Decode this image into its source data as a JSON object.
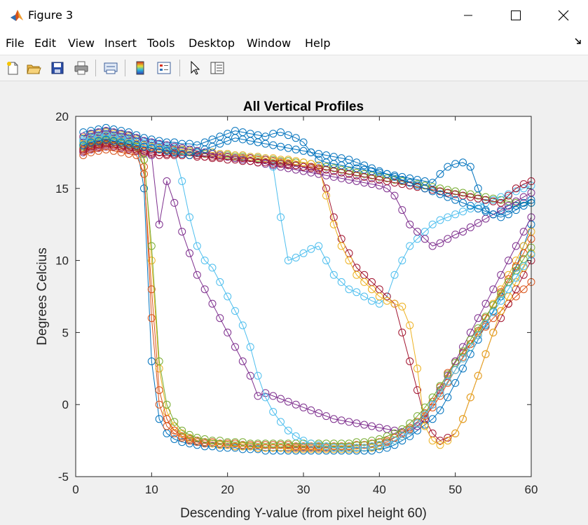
{
  "window": {
    "title": "Figure 3"
  },
  "menu": [
    "File",
    "Edit",
    "View",
    "Insert",
    "Tools",
    "Desktop",
    "Window",
    "Help"
  ],
  "toolbar_icons": [
    "new-figure-icon",
    "open-file-icon",
    "save-icon",
    "print-icon",
    "print-preview-icon",
    "colorbar-icon",
    "legend-icon",
    "pointer-icon",
    "property-inspector-icon"
  ],
  "chart_data": {
    "type": "line",
    "title": "All Vertical Profiles",
    "xlabel": "Descending Y-value (from pixel height 60)",
    "ylabel": "Degrees Celcius",
    "xlim": [
      0,
      60
    ],
    "ylim": [
      -5,
      20
    ],
    "xticks": [
      0,
      10,
      20,
      30,
      40,
      50,
      60
    ],
    "yticks": [
      -5,
      0,
      5,
      10,
      15,
      20
    ],
    "marker": "circle",
    "colors": [
      "#0072BD",
      "#D95319",
      "#EDB120",
      "#7E2F8E",
      "#77AC30",
      "#4DBEEE",
      "#A2142F"
    ],
    "x": [
      1,
      2,
      3,
      4,
      5,
      6,
      7,
      8,
      9,
      10,
      11,
      12,
      13,
      14,
      15,
      16,
      17,
      18,
      19,
      20,
      21,
      22,
      23,
      24,
      25,
      26,
      27,
      28,
      29,
      30,
      31,
      32,
      33,
      34,
      35,
      36,
      37,
      38,
      39,
      40,
      41,
      42,
      43,
      44,
      45,
      46,
      47,
      48,
      49,
      50,
      51,
      52,
      53,
      54,
      55,
      56,
      57,
      58,
      59,
      60
    ],
    "series": [
      {
        "values": [
          18.2,
          18.4,
          18.5,
          18.6,
          18.5,
          18.4,
          18.3,
          18.1,
          15.0,
          3.0,
          -1.0,
          -2.0,
          -2.4,
          -2.6,
          -2.7,
          -2.8,
          -2.9,
          -2.9,
          -3.0,
          -3.0,
          -3.0,
          -3.1,
          -3.1,
          -3.1,
          -3.2,
          -3.2,
          -3.2,
          -3.2,
          -3.2,
          -3.2,
          -3.2,
          -3.2,
          -3.2,
          -3.2,
          -3.2,
          -3.2,
          -3.2,
          -3.2,
          -3.2,
          -3.1,
          -3.0,
          -2.8,
          -2.5,
          -2.2,
          -1.8,
          -1.4,
          -1.0,
          -0.4,
          0.5,
          1.5,
          2.5,
          3.5,
          4.5,
          5.5,
          6.5,
          7.5,
          8.5,
          9.5,
          11.0,
          12.5
        ]
      },
      {
        "values": [
          17.8,
          18.0,
          18.1,
          18.2,
          18.2,
          18.1,
          18.0,
          17.9,
          16.5,
          6.0,
          0.0,
          -1.5,
          -2.0,
          -2.3,
          -2.5,
          -2.6,
          -2.7,
          -2.7,
          -2.8,
          -2.8,
          -2.9,
          -2.9,
          -2.9,
          -3.0,
          -3.0,
          -3.0,
          -3.0,
          -3.0,
          -3.0,
          -3.0,
          -3.0,
          -3.0,
          -3.0,
          -3.0,
          -3.0,
          -3.0,
          -3.0,
          -3.0,
          -2.9,
          -2.8,
          -2.6,
          -2.3,
          -2.0,
          -1.6,
          -1.2,
          -0.6,
          0.2,
          1.2,
          2.2,
          3.0,
          3.6,
          4.2,
          4.8,
          5.4,
          6.0,
          6.5,
          7.0,
          7.5,
          8.0,
          8.5
        ]
      },
      {
        "values": [
          18.5,
          18.7,
          18.8,
          18.9,
          18.8,
          18.7,
          18.6,
          18.4,
          17.5,
          10.0,
          2.5,
          -0.5,
          -1.5,
          -2.0,
          -2.3,
          -2.5,
          -2.6,
          -2.7,
          -2.8,
          -2.8,
          -2.9,
          -2.9,
          -2.9,
          -3.0,
          -3.0,
          -3.0,
          -3.0,
          -3.1,
          -3.1,
          -3.1,
          -3.1,
          -3.1,
          -3.1,
          -3.1,
          -3.1,
          -3.1,
          -3.1,
          -3.0,
          -3.0,
          -2.9,
          -2.7,
          -2.5,
          -2.2,
          -1.8,
          -1.3,
          -0.7,
          0.0,
          0.8,
          1.6,
          2.4,
          3.2,
          4.0,
          5.0,
          6.0,
          7.0,
          8.0,
          9.0,
          10.0,
          11.0,
          12.0
        ]
      },
      {
        "values": [
          17.5,
          17.7,
          17.8,
          17.9,
          17.9,
          17.8,
          17.7,
          17.6,
          17.4,
          17.3,
          12.5,
          15.5,
          14.0,
          12.0,
          10.5,
          9.0,
          8.0,
          7.0,
          6.0,
          5.0,
          4.0,
          3.0,
          2.0,
          0.6,
          0.8,
          0.6,
          0.4,
          0.2,
          0.0,
          -0.2,
          -0.4,
          -0.6,
          -0.8,
          -1.0,
          -1.1,
          -1.2,
          -1.3,
          -1.4,
          -1.5,
          -1.6,
          -1.7,
          -1.8,
          -1.9,
          -1.8,
          -1.5,
          -1.0,
          0.0,
          1.0,
          2.0,
          3.0,
          4.0,
          5.0,
          6.0,
          7.0,
          8.0,
          9.0,
          10.0,
          11.0,
          12.0,
          13.0
        ]
      },
      {
        "values": [
          18.0,
          18.2,
          18.3,
          18.4,
          18.3,
          18.2,
          18.1,
          18.0,
          17.9,
          17.8,
          17.7,
          17.7,
          17.6,
          17.6,
          17.5,
          17.5,
          17.4,
          17.4,
          17.3,
          17.3,
          17.2,
          17.2,
          17.1,
          17.1,
          17.0,
          17.0,
          16.9,
          16.9,
          16.8,
          16.8,
          16.7,
          16.6,
          16.5,
          16.4,
          16.3,
          16.2,
          16.1,
          16.0,
          15.9,
          15.8,
          15.7,
          15.6,
          15.5,
          15.4,
          15.3,
          15.2,
          15.1,
          15.0,
          14.9,
          14.8,
          14.7,
          14.6,
          14.5,
          14.4,
          14.3,
          14.2,
          14.1,
          14.0,
          14.0,
          14.0
        ]
      },
      {
        "values": [
          18.4,
          18.6,
          18.7,
          18.8,
          18.7,
          18.6,
          18.5,
          18.3,
          18.2,
          18.1,
          18.0,
          17.9,
          17.8,
          17.7,
          17.6,
          17.6,
          17.5,
          17.5,
          17.4,
          17.4,
          17.3,
          17.3,
          17.2,
          17.2,
          17.1,
          16.5,
          13.0,
          10.0,
          10.2,
          10.5,
          10.8,
          11.0,
          10.0,
          9.0,
          8.5,
          8.0,
          7.8,
          7.5,
          7.2,
          7.0,
          7.5,
          9.0,
          10.0,
          11.0,
          11.5,
          12.0,
          12.5,
          12.8,
          13.0,
          13.2,
          13.4,
          13.6,
          13.8,
          14.0,
          14.2,
          14.4,
          14.6,
          14.8,
          15.0,
          15.2
        ]
      },
      {
        "values": [
          17.6,
          17.8,
          17.9,
          18.0,
          17.9,
          17.8,
          17.7,
          17.6,
          17.5,
          17.4,
          17.3,
          17.3,
          17.3,
          17.3,
          17.3,
          17.3,
          17.2,
          17.2,
          17.2,
          17.2,
          17.1,
          17.1,
          17.1,
          17.0,
          17.0,
          16.9,
          16.8,
          16.7,
          16.6,
          16.5,
          16.4,
          16.3,
          15.0,
          13.0,
          11.5,
          10.5,
          9.5,
          9.0,
          8.5,
          8.0,
          7.5,
          7.0,
          5.0,
          3.0,
          1.0,
          -1.0,
          -2.0,
          -2.5,
          -2.3,
          -2.0,
          -1.0,
          0.5,
          2.0,
          3.5,
          5.0,
          6.0,
          7.0,
          8.0,
          9.0,
          10.0
        ]
      },
      {
        "values": [
          18.9,
          19.0,
          19.1,
          19.2,
          19.1,
          19.0,
          18.9,
          18.7,
          18.5,
          18.4,
          18.3,
          18.2,
          18.2,
          18.1,
          18.1,
          18.0,
          18.2,
          18.4,
          18.6,
          18.8,
          19.0,
          18.9,
          18.8,
          18.7,
          18.6,
          18.8,
          18.9,
          18.7,
          18.5,
          18.2,
          17.5,
          17.0,
          16.8,
          16.7,
          16.6,
          16.5,
          16.4,
          16.3,
          16.2,
          16.1,
          16.0,
          15.9,
          15.8,
          15.7,
          15.6,
          15.5,
          15.4,
          16.0,
          16.5,
          16.7,
          16.8,
          16.5,
          15.0,
          13.5,
          13.2,
          13.4,
          13.6,
          13.8,
          14.0,
          14.2
        ]
      },
      {
        "values": [
          17.3,
          17.5,
          17.6,
          17.7,
          17.6,
          17.5,
          17.4,
          17.3,
          16.0,
          8.0,
          1.0,
          -1.0,
          -1.8,
          -2.2,
          -2.4,
          -2.5,
          -2.6,
          -2.6,
          -2.7,
          -2.7,
          -2.7,
          -2.8,
          -2.8,
          -2.8,
          -2.8,
          -2.8,
          -2.8,
          -2.8,
          -2.9,
          -2.9,
          -2.9,
          -2.9,
          -2.9,
          -2.9,
          -2.9,
          -2.9,
          -2.8,
          -2.8,
          -2.7,
          -2.6,
          -2.5,
          -2.3,
          -2.0,
          -1.7,
          -1.3,
          -0.8,
          -0.2,
          0.6,
          1.5,
          2.4,
          3.3,
          4.2,
          5.1,
          6.0,
          6.9,
          7.8,
          8.7,
          9.6,
          10.5,
          11.5
        ]
      },
      {
        "values": [
          18.1,
          18.3,
          18.4,
          18.5,
          18.4,
          18.3,
          18.2,
          18.1,
          18.0,
          17.9,
          17.8,
          17.8,
          17.7,
          17.7,
          17.6,
          17.6,
          17.5,
          17.5,
          17.4,
          17.4,
          17.3,
          17.3,
          17.2,
          17.2,
          17.1,
          17.1,
          17.0,
          17.0,
          16.9,
          16.8,
          16.7,
          16.6,
          14.5,
          12.5,
          11.0,
          10.0,
          9.0,
          8.5,
          8.0,
          7.5,
          7.2,
          7.0,
          6.8,
          5.5,
          2.5,
          -1.5,
          -2.5,
          -2.8,
          -2.5,
          -2.0,
          -1.0,
          0.5,
          2.0,
          3.5,
          5.0,
          6.5,
          7.5,
          8.5,
          9.5,
          10.5
        ]
      },
      {
        "values": [
          18.6,
          18.8,
          18.9,
          19.0,
          18.9,
          18.8,
          18.7,
          18.5,
          18.3,
          18.2,
          18.1,
          18.0,
          17.9,
          17.8,
          17.7,
          17.6,
          17.5,
          17.4,
          17.3,
          17.2,
          17.1,
          17.0,
          16.9,
          16.8,
          16.7,
          16.6,
          16.5,
          16.4,
          16.3,
          16.2,
          16.1,
          16.0,
          15.9,
          15.8,
          15.7,
          15.6,
          15.5,
          15.4,
          15.3,
          15.2,
          15.0,
          14.5,
          13.5,
          12.5,
          12.0,
          11.5,
          11.0,
          11.2,
          11.5,
          11.8,
          12.0,
          12.3,
          12.6,
          12.9,
          13.2,
          13.5,
          13.8,
          14.1,
          14.4,
          14.7
        ]
      },
      {
        "values": [
          17.9,
          18.1,
          18.2,
          18.3,
          18.2,
          18.1,
          18.0,
          17.9,
          17.0,
          11.0,
          3.0,
          0.0,
          -1.2,
          -1.8,
          -2.1,
          -2.3,
          -2.4,
          -2.5,
          -2.5,
          -2.6,
          -2.6,
          -2.6,
          -2.7,
          -2.7,
          -2.7,
          -2.7,
          -2.7,
          -2.7,
          -2.7,
          -2.7,
          -2.7,
          -2.7,
          -2.7,
          -2.7,
          -2.7,
          -2.7,
          -2.6,
          -2.6,
          -2.5,
          -2.4,
          -2.2,
          -2.0,
          -1.7,
          -1.3,
          -0.8,
          -0.2,
          0.5,
          1.3,
          2.1,
          2.9,
          3.7,
          4.5,
          5.3,
          6.1,
          6.9,
          7.7,
          8.5,
          9.3,
          10.1,
          10.9
        ]
      },
      {
        "values": [
          18.3,
          18.5,
          18.6,
          18.7,
          18.6,
          18.5,
          18.4,
          18.2,
          18.1,
          18.0,
          17.9,
          17.8,
          17.5,
          15.5,
          13.0,
          11.0,
          10.0,
          9.5,
          8.5,
          7.5,
          6.5,
          5.5,
          4.0,
          2.0,
          0.5,
          -0.5,
          -1.2,
          -1.8,
          -2.2,
          -2.5,
          -2.7,
          -2.8,
          -2.9,
          -3.0,
          -3.0,
          -3.0,
          -3.0,
          -3.0,
          -2.9,
          -2.8,
          -2.7,
          -2.5,
          -2.2,
          -1.8,
          -1.3,
          -0.7,
          0.0,
          0.8,
          1.6,
          2.4,
          3.2,
          4.0,
          4.8,
          5.6,
          6.4,
          7.2,
          8.0,
          8.8,
          9.6,
          10.4
        ]
      },
      {
        "values": [
          17.7,
          17.9,
          18.0,
          18.1,
          18.0,
          17.9,
          17.8,
          17.7,
          17.6,
          17.5,
          17.5,
          17.4,
          17.4,
          17.3,
          17.3,
          17.2,
          17.2,
          17.1,
          17.1,
          17.0,
          17.0,
          16.9,
          16.9,
          16.8,
          16.8,
          16.7,
          16.7,
          16.6,
          16.6,
          16.5,
          16.5,
          16.4,
          16.3,
          16.2,
          16.1,
          16.0,
          15.9,
          15.8,
          15.7,
          15.6,
          15.5,
          15.4,
          15.3,
          15.2,
          15.1,
          15.0,
          14.9,
          14.8,
          14.7,
          14.6,
          14.5,
          14.4,
          14.3,
          14.2,
          14.1,
          14.0,
          14.5,
          15.0,
          15.3,
          15.5
        ]
      },
      {
        "values": [
          18.0,
          18.2,
          18.3,
          18.4,
          18.3,
          18.2,
          18.1,
          18.0,
          17.9,
          17.8,
          17.7,
          17.6,
          17.5,
          17.4,
          17.3,
          17.5,
          17.7,
          17.9,
          18.1,
          18.3,
          18.5,
          18.4,
          18.3,
          18.2,
          18.1,
          18.0,
          17.9,
          17.8,
          17.7,
          17.6,
          17.5,
          17.4,
          17.3,
          17.2,
          17.1,
          17.0,
          16.8,
          16.6,
          16.4,
          16.2,
          16.0,
          15.8,
          15.6,
          15.4,
          15.2,
          15.0,
          14.8,
          14.6,
          14.4,
          14.2,
          14.0,
          13.8,
          13.6,
          13.4,
          13.2,
          13.0,
          13.2,
          13.5,
          13.8,
          14.0
        ]
      }
    ]
  }
}
